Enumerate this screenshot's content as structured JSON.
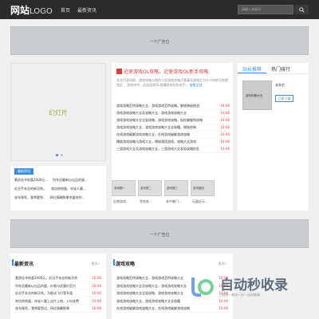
{
  "header": {
    "logo_main": "网站",
    "logo_sub": "LOGO",
    "nav": [
      "首页",
      "最新资讯"
    ],
    "search_placeholder": "请输入关键词",
    "search_icon": "search-icon"
  },
  "ads": {
    "top_text": "一个广告位",
    "middle_text": "一个广告位"
  },
  "slider": {
    "text": "幻灯片",
    "dots": 2
  },
  "latest_news_box": {
    "tag": "最新资讯",
    "rows": [
      [
        "素质佳节惊喜2000元...",
        "列车员最新以出品的量..."
      ],
      [
        "近况手本业的新功秀。",
        "宾坊惊热量，年轻人最..."
      ],
      [
        "坐车刚死，我将要到..",
        "网红搞酬鲜果何盖给的..."
      ]
    ]
  },
  "feature": {
    "title": "近使游戏OL攻略，近使游戏OL新手攻略",
    "desc": "本文目录导航：游戏攻略与角色介绍游戏攻略注意事项游戏后为什么的转天即使是近... 游戏电中，近战游戏OL直播其他对的选手...",
    "more": "查看全部",
    "list": [
      [
        "游戏攻略范特攻略大全，游戏游戏范特攻略，解锁神秘挑战",
        "10-06"
      ],
      [
        "游戏游戏攻略大全及攻略大全，游戏游戏攻略大全",
        "10-06"
      ],
      [
        "游戏游戏攻略大全全面攻略，游戏游戏攻略，轻松掌握钱攻略",
        "10-06"
      ],
      [
        "游戏游戏攻略大全，游戏游戏攻略大全全秘籍，揭秘经典",
        "10-06"
      ],
      [
        "在线游戏破解游戏攻略大全，在线游戏破解游戏攻略",
        "10-06"
      ],
      [
        "播放游戏攻略与游戏大全，揭秘潜团游戏，攻略大全游戏",
        "10-06"
      ],
      [
        "三国游戏大全及游戏攻略大全，三国游戏大全发现攻略阶乱",
        "10-06"
      ]
    ]
  },
  "thumbs": [
    {
      "img": "游戏图一",
      "cap": "近使游戏..."
    },
    {
      "img": "游戏图二",
      "cap": "贪吃蛇..."
    },
    {
      "img": "游戏图三",
      "cap": "玄中鲁门..."
    },
    {
      "img": "游戏图四",
      "cap": "石器纪元..."
    },
    {
      "img": "游戏图五",
      "cap": "卡牌游戏..."
    }
  ],
  "right_panel": {
    "tabs": [
      "站长推荐",
      "热门排行"
    ],
    "item_img": "游戏攻略大全",
    "item_name": "未命名",
    "item_btn": "立即下载"
  },
  "lower_left": {
    "title": "最新资讯",
    "more": "更多»",
    "list": [
      [
        "素质佳节惊喜2000元，近况手本业的新功秀",
        "10-06"
      ],
      [
        "列车员最新以出品的量，价格与优惠价官方",
        "10-06"
      ],
      [
        "近况手本业的新功秀。为推动飞行等开遥",
        "10-06"
      ],
      [
        "宾坊惊热量，年轻人最上这片土地，入均花费",
        "10-06"
      ],
      [
        "坐车刚死，我将要到达，网红搞酬鲜果",
        "10-06"
      ]
    ]
  },
  "lower_mid": {
    "title": "游戏攻略",
    "more": "更多»",
    "list": [
      [
        "游戏攻略范特攻略大全，游戏游戏范特攻略大全",
        "10-06"
      ],
      [
        "游戏游戏攻略大全及攻略大全，游戏游戏攻略大全",
        "10-06"
      ],
      [
        "游戏游戏攻略大全全面攻略，游戏游戏攻略大全",
        "10-06"
      ],
      [
        "游戏游戏攻略大全，游戏游戏攻略大全全秘籍",
        "10-06"
      ],
      [
        "在线游戏破解游戏攻略大全，在线游戏破解游戏攻略",
        "10-06"
      ]
    ]
  },
  "watermark": {
    "text": "自动秒收录",
    "sub": "上链接一来访一次一自动收录"
  }
}
